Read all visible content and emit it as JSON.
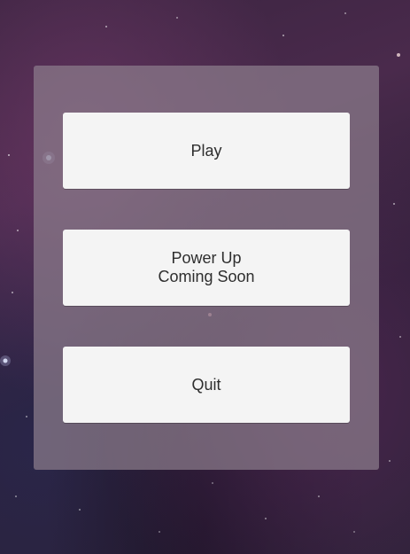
{
  "menu": {
    "play_label": "Play",
    "powerup_line1": "Power Up",
    "powerup_line2": "Coming Soon",
    "quit_label": "Quit"
  }
}
